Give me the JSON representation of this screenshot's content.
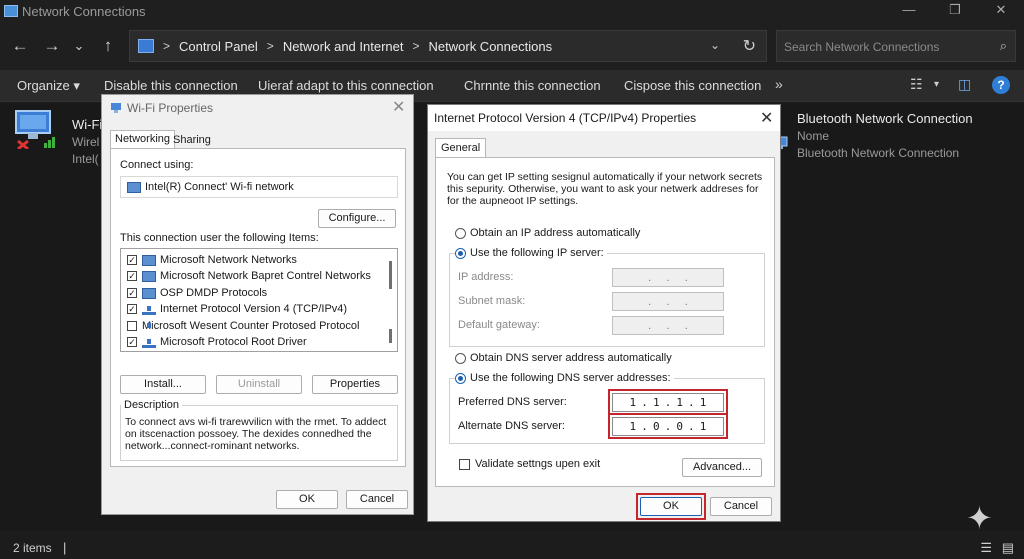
{
  "window": {
    "title": "Network Connections",
    "minimize": "—",
    "maximize": "❐",
    "close": "✕"
  },
  "nav": {
    "back": "←",
    "forward": "→",
    "history": "⌄",
    "up": "↑",
    "breadcrumb": [
      "Control Panel",
      "Network and Internet",
      "Network Connections"
    ],
    "separator": ">",
    "dropdown": "⌄",
    "refresh": "↻"
  },
  "search": {
    "placeholder": "Search Network Connections",
    "icon": "⌕"
  },
  "commands": {
    "organize": "Organize ▾",
    "disable": "Disable this connection",
    "adapt": "Uieraf adapt to this connection",
    "chrnnte": "Chrnnte this connection",
    "cispose": "Cispose this connection",
    "more": "»",
    "view_icon": "☷",
    "view_caret": "▾",
    "pane_icon": "◫",
    "help_icon": "?"
  },
  "connections": {
    "wifi": {
      "name": "Wi-Fi",
      "line1": "Wirel",
      "line2": "Intel("
    },
    "bluetooth": {
      "name": "Bluetooth Network Connection",
      "status": "Nome",
      "device": "Bluetooth Network Connection"
    }
  },
  "status": {
    "items": "2 items",
    "caret": "|"
  },
  "wifi_props": {
    "title": "Wi-Fi Properties",
    "close": "✕",
    "tab_networking": "Networking",
    "tab_sharing": "Sharing",
    "connect_using_label": "Connect using:",
    "adapter": "Intel(R) Connect' Wi-fi network",
    "configure": "Configure...",
    "items_label": "This connection user the following Items:",
    "items": [
      {
        "label": "Microsoft Network Networks",
        "checked": "✓"
      },
      {
        "label": "Microsoft Network Bapret Contrel Networks",
        "checked": "✓"
      },
      {
        "label": "OSP DMDP Protocols",
        "checked": "✓"
      },
      {
        "label": "Internet Protocol Version 4 (TCP/IPv4)",
        "checked": "✓"
      },
      {
        "label": "Microsoft Wesent Counter Protosed Protocol",
        "checked": ""
      },
      {
        "label": "Microsoft Protocol Root Driver",
        "checked": "✓"
      }
    ],
    "install": "Install...",
    "uninstall": "Uninstall",
    "properties": "Properties",
    "description_label": "Description",
    "description_line1": "To connect avs wi-fi trarewvilicn with the rmet. To addect",
    "description_line2": "on itscenaction possoey. The dexides connedhed the",
    "description_line3": "network...connect-rominant networks.",
    "ok": "OK",
    "cancel": "Cancel"
  },
  "ipv4_props": {
    "title": "Internet Protocol Version 4 (TCP/IPv4) Properties",
    "close": "✕",
    "tab_general": "General",
    "intro_line1": "You can get IP setting sesignul automatically if your network secrets",
    "intro_line2": "this sepurity. Otherwise, you want to ask your netwerk addreses for",
    "intro_line3": "for the aupneoot IP settings.",
    "obtain_ip": "Obtain an IP address automatically",
    "use_ip": "Use the following IP server:",
    "ip_address": "IP address:",
    "subnet_mask": "Subnet mask:",
    "default_gateway": "Default gateway:",
    "empty_dots": ".     .     .",
    "obtain_dns": "Obtain DNS server address automatically",
    "use_dns": "Use the following DNS server addresses:",
    "preferred_dns_label": "Preferred DNS server:",
    "alternate_dns_label": "Alternate DNS server:",
    "preferred_dns": [
      "1",
      ".",
      "1",
      ".",
      "1",
      ".",
      "1"
    ],
    "alternate_dns": [
      "1",
      ".",
      "0",
      ".",
      "0",
      ".",
      "1"
    ],
    "validate": "Validate settngs upen exit",
    "advanced": "Advanced...",
    "ok": "OK",
    "cancel": "Cancel"
  },
  "colors": {
    "highlight": "#c4262e",
    "radio_selected": "#1a5fb4"
  }
}
